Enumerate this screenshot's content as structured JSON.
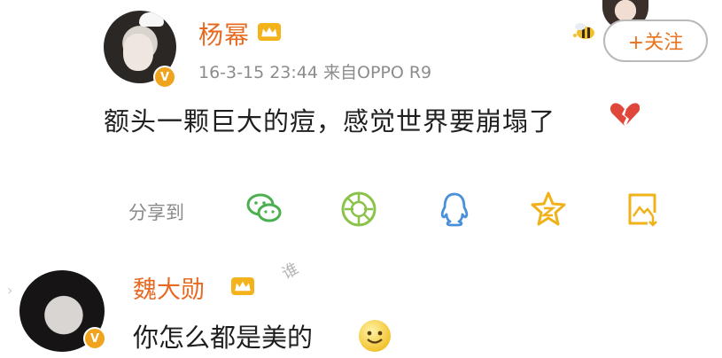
{
  "post": {
    "username": "杨幂",
    "meta": "16-3-15 23:44  来自OPPO R9",
    "text": "额头一颗巨大的痘，感觉世界要崩塌了",
    "follow_label": "+关注",
    "verified_badge": "V",
    "vip_icon": "crown-icon",
    "emoji_icon": "broken-heart-icon"
  },
  "share": {
    "label": "分享到",
    "icons": [
      "wechat-icon",
      "moments-icon",
      "qq-icon",
      "qzone-icon",
      "save-image-icon"
    ]
  },
  "comment": {
    "username": "魏大勋",
    "text": "你怎么都是美的",
    "verified_badge": "V",
    "emoji_icon": "smiley-icon",
    "watermark": "谁"
  },
  "colors": {
    "username": "#e86a22",
    "accent_green": "#4caf50",
    "accent_blue": "#4a90d9",
    "accent_yellow": "#f0b21a",
    "badge": "#f0a31c"
  }
}
